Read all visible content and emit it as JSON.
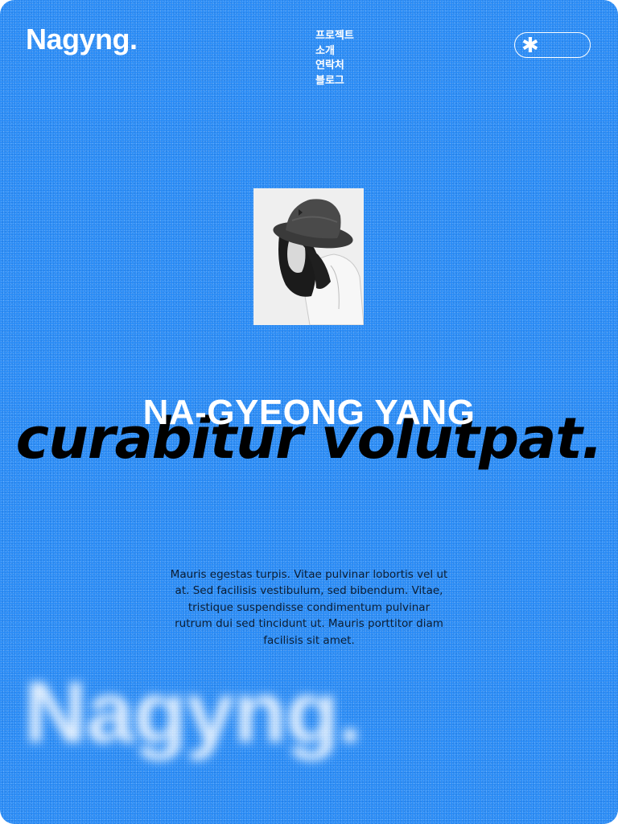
{
  "brand": {
    "logo": "Nagyng."
  },
  "nav": {
    "items": [
      "프로젝트",
      "소개",
      "연락처",
      "블로그"
    ]
  },
  "menu_toggle": {
    "icon": "asterisk-icon",
    "glyph": "✱"
  },
  "hero": {
    "name": "NA-GYEONG YANG",
    "slogan": "curabitur volutpat.",
    "description": "Mauris egestas turpis. Vitae pulvinar lobortis vel ut at. Sed facilisis vestibulum, sed bibendum. Vitae, tristique suspendisse condimentum pulvinar rutrum dui sed tincidunt ut. Mauris porttitor diam facilisis sit amet."
  },
  "footer": {
    "big_logo": "Nagyng."
  },
  "colors": {
    "background": "#2a8cf6",
    "text_light": "#ffffff",
    "text_dark": "#000000"
  }
}
